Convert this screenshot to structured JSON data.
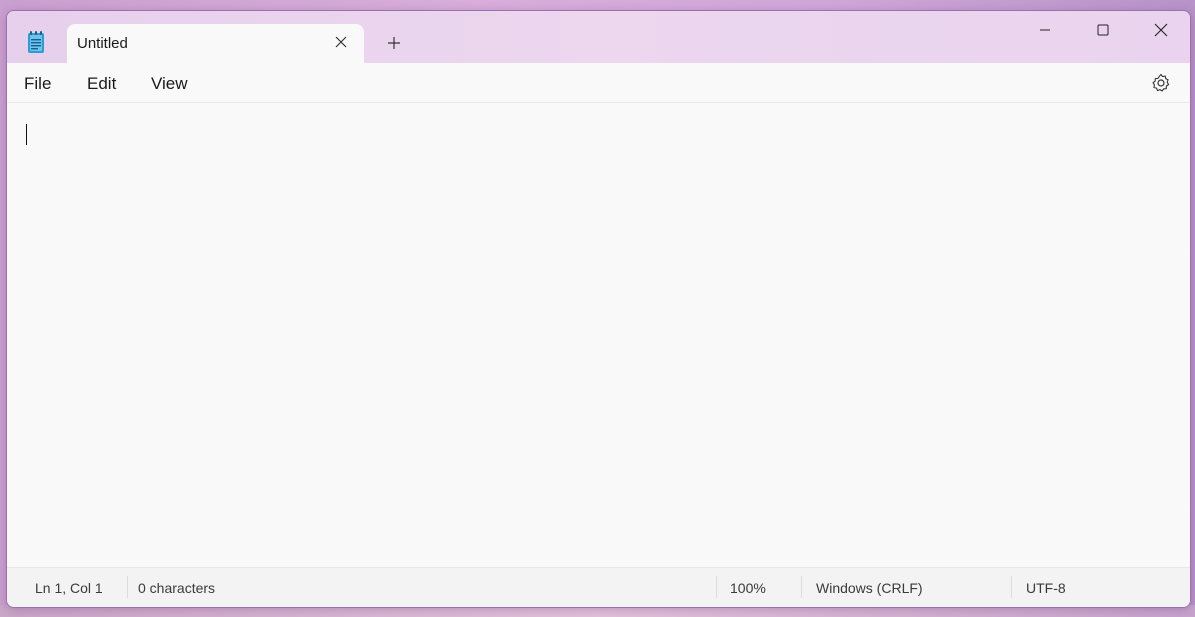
{
  "tab": {
    "title": "Untitled"
  },
  "menu": {
    "file": "File",
    "edit": "Edit",
    "view": "View"
  },
  "editor": {
    "content": ""
  },
  "status": {
    "position": "Ln 1, Col 1",
    "characters": "0 characters",
    "zoom": "100%",
    "line_ending": "Windows (CRLF)",
    "encoding": "UTF-8"
  },
  "icons": {
    "app": "notepad-icon",
    "tab_close": "close-icon",
    "new_tab": "plus-icon",
    "minimize": "minimize-icon",
    "maximize": "maximize-icon",
    "close": "close-icon",
    "settings": "gear-icon"
  },
  "colors": {
    "window_bg": "#f9f9f9",
    "titlebar": "#ecd7ef",
    "border": "#9c6fb0",
    "text": "#1a1a1a"
  }
}
